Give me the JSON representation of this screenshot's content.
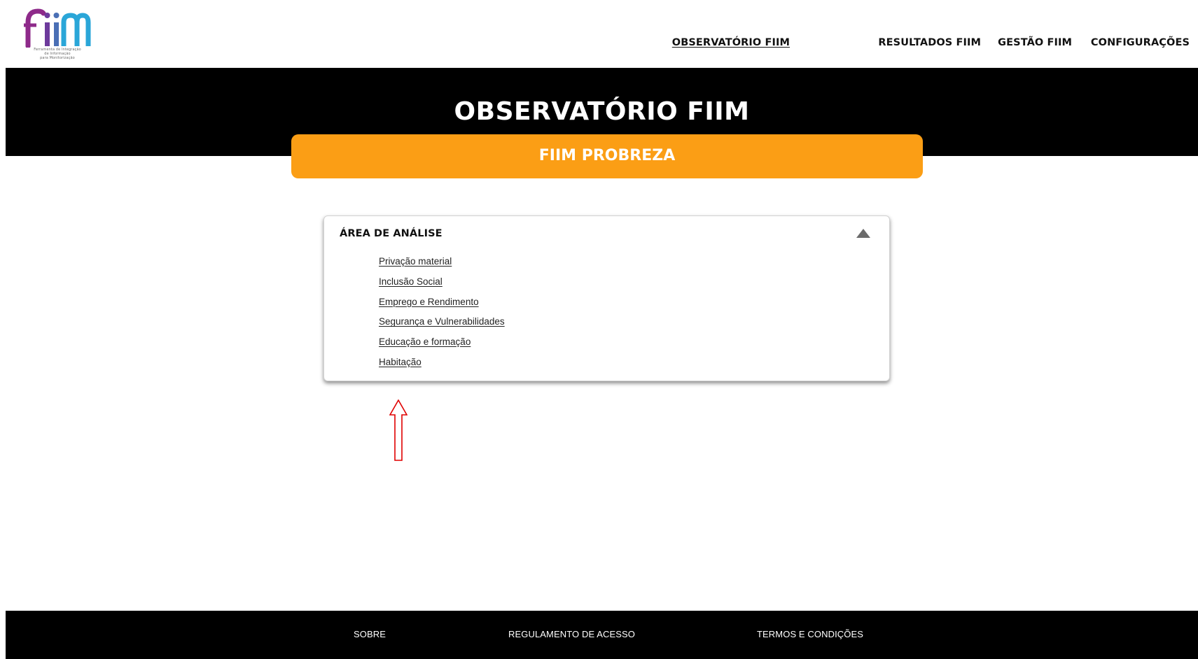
{
  "logo": {
    "text": "fiim",
    "subtitle_lines": [
      "Ferramenta de Integração",
      "de Informação",
      "para Monitorização"
    ],
    "colors": {
      "f": "#8e2a8a",
      "i1": "#6d3a9c",
      "i2": "#4a6fb5",
      "m": "#2aa6d8"
    }
  },
  "nav": {
    "items": [
      {
        "label": "OBSERVATÓRIO FIIM",
        "active": true
      },
      {
        "label": "RESULTADOS FIIM",
        "active": false
      },
      {
        "label": "GESTÃO FIIM",
        "active": false
      },
      {
        "label": "CONFIGURAÇÕES",
        "active": false
      }
    ]
  },
  "hero": {
    "title": "OBSERVATÓRIO FIIM",
    "subtitle": "FIIM PROBREZA",
    "accent_color": "#fb9e15"
  },
  "analysis": {
    "title": "ÁREA DE ANÁLISE",
    "collapse_icon": "triangle-up-icon",
    "items": [
      {
        "label": "Privação material"
      },
      {
        "label": "Inclusão Social"
      },
      {
        "label": "Emprego e Rendimento"
      },
      {
        "label": "Segurança e Vulnerabilidades"
      },
      {
        "label": "Educação e formação"
      },
      {
        "label": "Habitação"
      }
    ]
  },
  "annotation": {
    "icon": "red-up-arrow-icon",
    "color": "#e00000"
  },
  "footer": {
    "links": [
      {
        "label": "SOBRE"
      },
      {
        "label": "REGULAMENTO DE ACESSO"
      },
      {
        "label": "TERMOS E CONDIÇÕES"
      }
    ]
  }
}
